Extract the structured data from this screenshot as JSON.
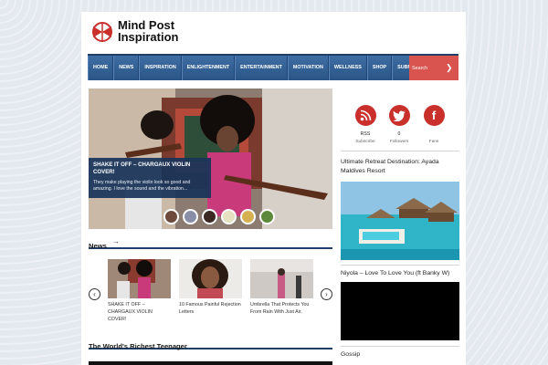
{
  "site": {
    "logo_line1": "Mind Post",
    "logo_line2": "Inspiration"
  },
  "nav": {
    "items": [
      "HOME",
      "NEWS",
      "INSPIRATION",
      "ENLIGHTENMENT",
      "ENTERTAINMENT",
      "MOTIVATION",
      "WELLNESS",
      "SHOP",
      "SUBMIT YOUR WORK"
    ],
    "search_placeholder": "Search"
  },
  "slider": {
    "title": "SHAKE IT OFF – CHARGAUX VIOLIN COVER!",
    "excerpt": "They make playing the violin look so good and amazing. I love the sound and the vibration..."
  },
  "news": {
    "heading": "News",
    "cards": [
      {
        "title": "SHAKE IT OFF – CHARGAUX VIOLIN COVER!"
      },
      {
        "title": "10 Famous Painful Rejection Letters"
      },
      {
        "title": "Umbrella That Protects You From Rain With Just Air."
      }
    ]
  },
  "richest": {
    "heading": "The World's Richest Teenager"
  },
  "sidebar": {
    "social": [
      {
        "name": "RSS",
        "sub": "Subscribe",
        "icon": "rss-icon"
      },
      {
        "name": "0",
        "sub": "Followers",
        "icon": "twitter-icon"
      },
      {
        "name": "",
        "sub": "Fans",
        "icon": "facebook-icon"
      }
    ],
    "post1_title": "Ultimate Retreat Destination: Ayada Maldives Resort",
    "post2_title": "Niyola – Love To Love You (ft Banky W)",
    "post3_title": "Gossip"
  },
  "colors": {
    "nav_blue": "#2f5b8f",
    "accent_red": "#c9302c",
    "caption_bg": "#18345a"
  }
}
